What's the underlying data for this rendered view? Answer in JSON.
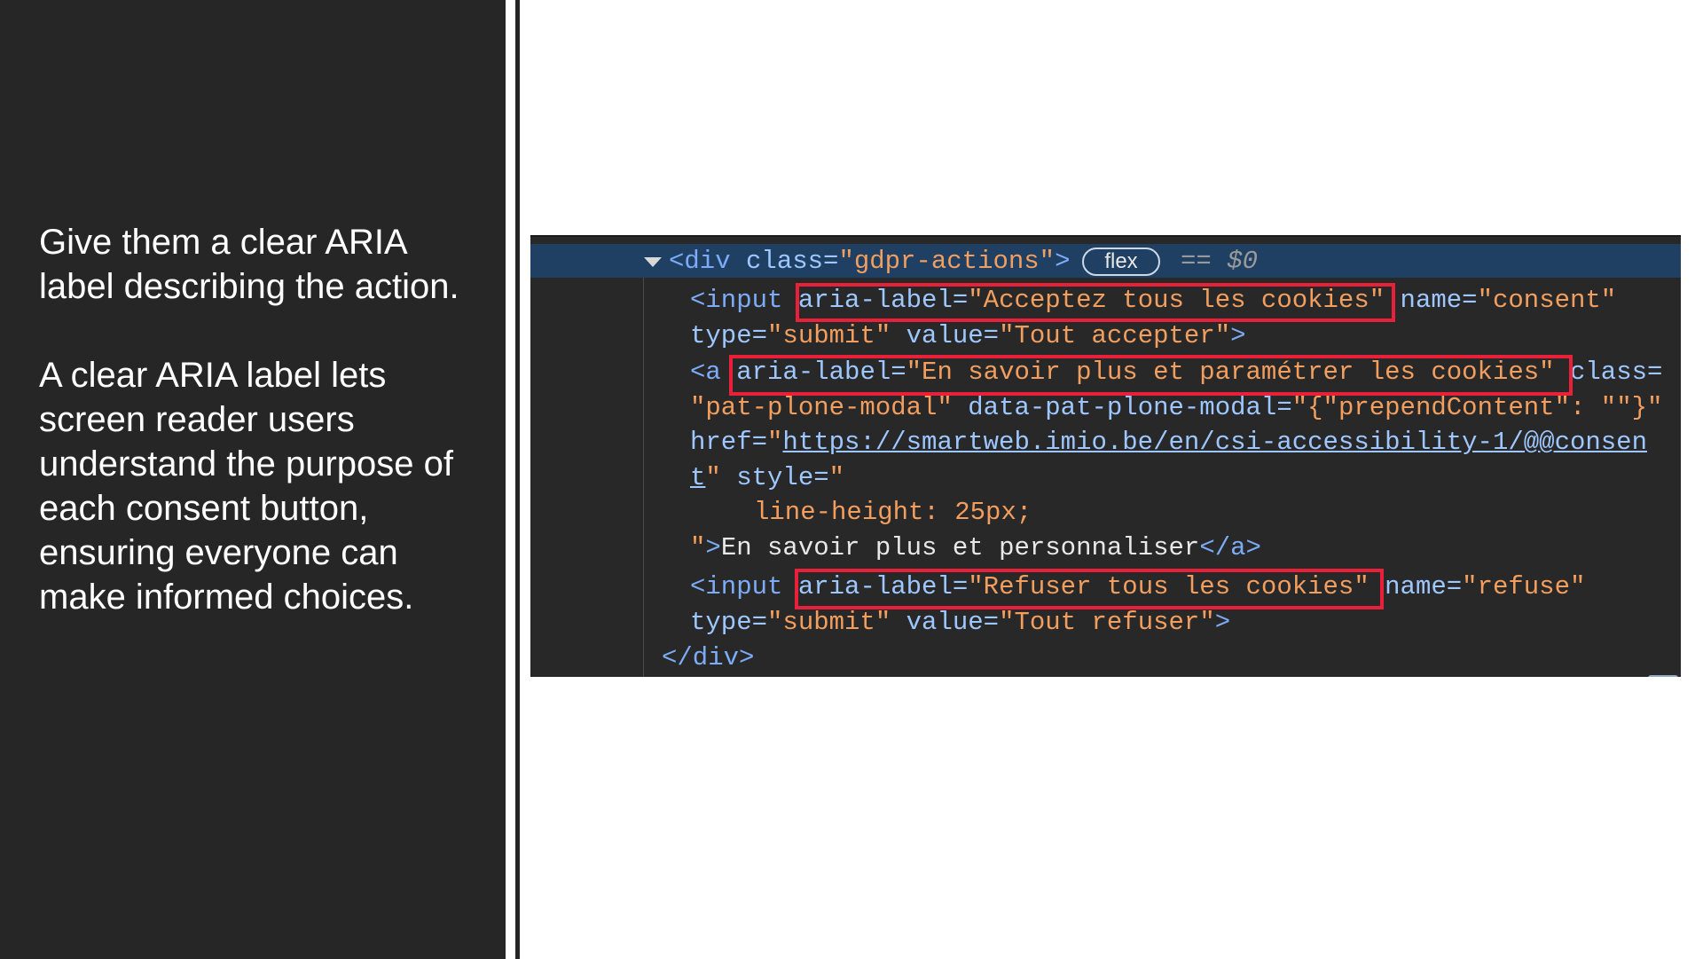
{
  "left_panel": {
    "paragraph_1": "Give them a clear ARIA label describing the action.",
    "paragraph_2": "A clear ARIA label lets screen reader users understand the purpose of each consent button, ensuring everyone can make informed choices."
  },
  "devtools": {
    "line1": {
      "open": "<div ",
      "attr": "class=",
      "val": "\"gdpr-actions\"",
      "close": ">",
      "badge": "flex",
      "eq": "== $0"
    },
    "line2": {
      "tag": "<input ",
      "a1": "aria-label=",
      "v1": "\"Acceptez tous les cookies\"",
      "a2": " name=",
      "v2": "\"consent\""
    },
    "line3": {
      "a1": "type=",
      "v1": "\"submit\"",
      "a2": " value=",
      "v2": "\"Tout accepter\"",
      "close": ">"
    },
    "line4": {
      "tag": "<a ",
      "a1": "aria-label=",
      "v1": "\"En savoir plus et paramétrer les cookies\"",
      "a2": " class="
    },
    "line5": {
      "v1": "\"pat-plone-modal\"",
      "a2": " data-pat-plone-modal=",
      "v2": "\"{\"prependContent\": \"\"}\""
    },
    "line6": {
      "a1": "href=",
      "q": "\"",
      "link": "https://smartweb.imio.be/en/csi-accessibility-1/@@consen"
    },
    "line7": {
      "link": "t",
      "q": "\"",
      "a2": " style=",
      "v2": "\""
    },
    "line8": {
      "v1": "line-height: 25px;"
    },
    "line9": {
      "q": "\"",
      "close": ">",
      "text": "En savoir plus et personnaliser",
      "end": "</a>"
    },
    "line10": {
      "tag": "<input ",
      "a1": "aria-label=",
      "v1": "\"Refuser tous les cookies\"",
      "a2": " name=",
      "v2": "\"refuse\""
    },
    "line11": {
      "a1": "type=",
      "v1": "\"submit\"",
      "a2": " value=",
      "v2": "\"Tout refuser\"",
      "close": ">"
    },
    "line12": {
      "end": "</div>"
    }
  },
  "colors": {
    "panel_bg": "#262626",
    "devtools_bg": "#282828",
    "selected_row": "#1f3f63",
    "highlight_box": "#e8203a",
    "tag_blue": "#7cacf8",
    "string_orange": "#f29e5f"
  }
}
